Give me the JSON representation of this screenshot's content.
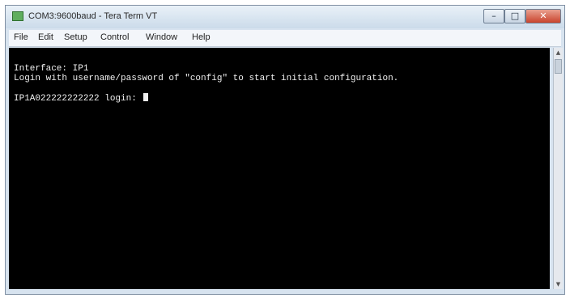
{
  "window": {
    "title": "COM3:9600baud - Tera Term VT",
    "controls": {
      "minimize": "–",
      "maximize": "□",
      "close": "✕"
    }
  },
  "menu": {
    "items": [
      {
        "label": "File"
      },
      {
        "label": "Edit"
      },
      {
        "label": "Setup"
      },
      {
        "label": "Control"
      },
      {
        "label": "Window"
      },
      {
        "label": "Help"
      }
    ]
  },
  "terminal": {
    "lines": [
      "Interface: IP1",
      "Login with username/password of \"config\" to start initial configuration.",
      "",
      "IP1A022222222222 login: "
    ]
  },
  "scrollbar": {
    "up": "▲",
    "down": "▼"
  },
  "colors": {
    "terminal_bg": "#000000",
    "terminal_fg": "#f0f0f0",
    "close_button": "#c9432c"
  }
}
